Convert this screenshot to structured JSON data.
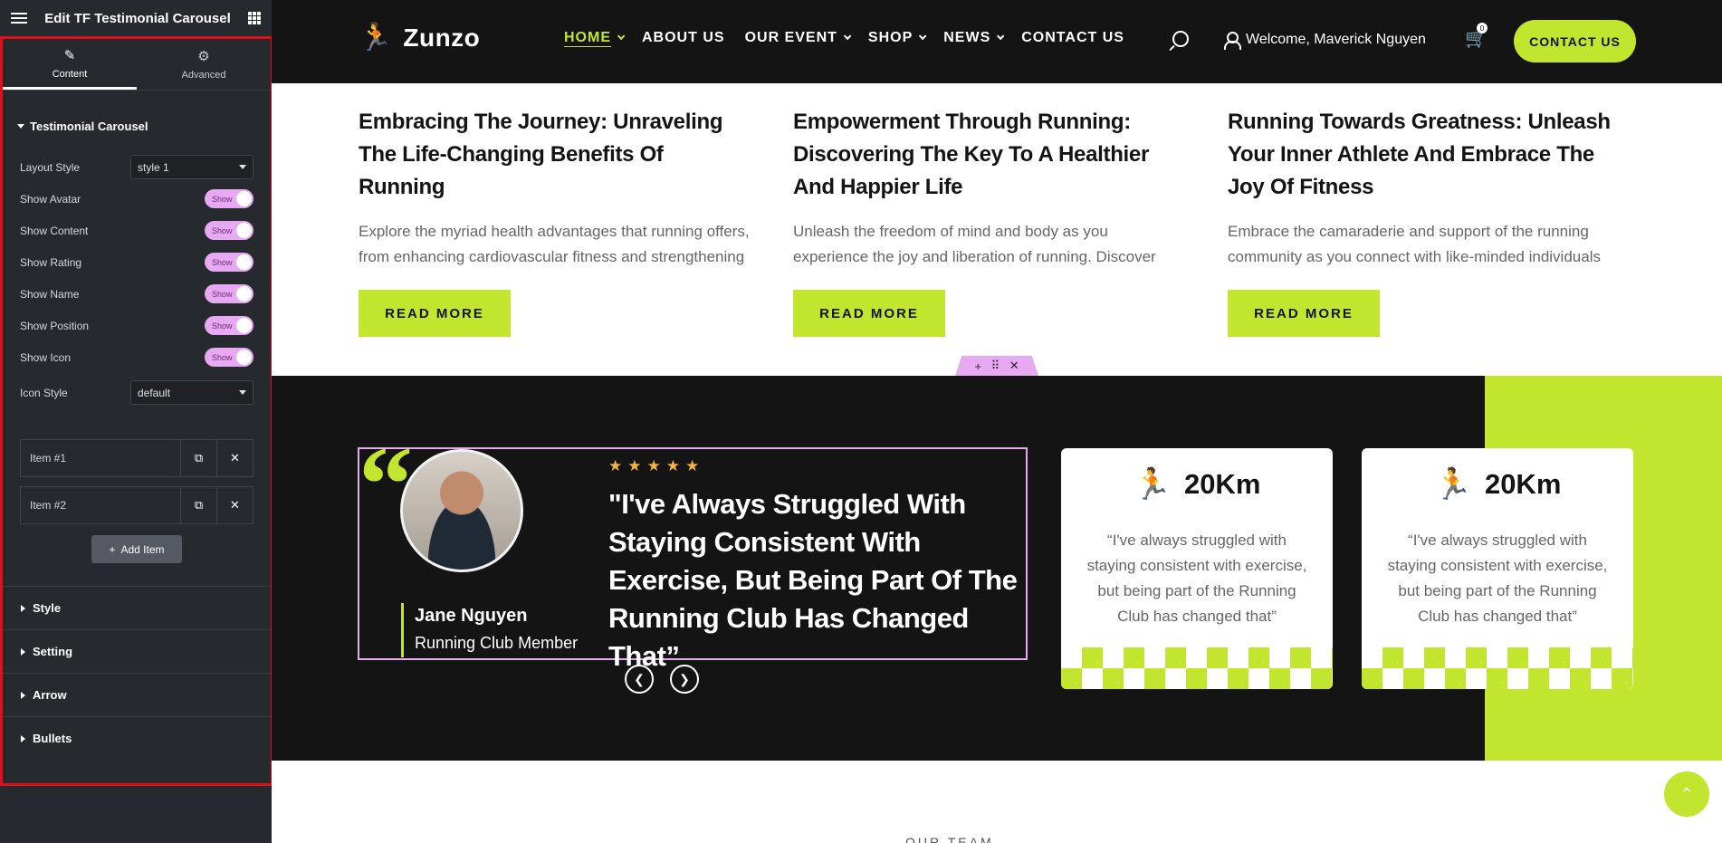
{
  "editor": {
    "title": "Edit TF Testimonial Carousel",
    "tabs": [
      {
        "label": "Content",
        "icon": "pencil-icon"
      },
      {
        "label": "Advanced",
        "icon": "gear-icon"
      }
    ],
    "section_title": "Testimonial Carousel",
    "layout_style": {
      "label": "Layout Style",
      "value": "style 1"
    },
    "toggles": [
      {
        "label": "Show Avatar",
        "state": "Show"
      },
      {
        "label": "Show Content",
        "state": "Show"
      },
      {
        "label": "Show Rating",
        "state": "Show"
      },
      {
        "label": "Show Name",
        "state": "Show"
      },
      {
        "label": "Show Position",
        "state": "Show"
      },
      {
        "label": "Show Icon",
        "state": "Show"
      }
    ],
    "icon_style": {
      "label": "Icon Style",
      "value": "default"
    },
    "items": [
      "Item #1",
      "Item #2"
    ],
    "add_item": "Add Item",
    "collapsed_sections": [
      "Style",
      "Setting",
      "Arrow",
      "Bullets"
    ]
  },
  "site": {
    "logo": "Zunzo",
    "nav": [
      {
        "label": "HOME",
        "dropdown": true,
        "active": true
      },
      {
        "label": "ABOUT US",
        "dropdown": false,
        "active": false
      },
      {
        "label": "OUR EVENT",
        "dropdown": true,
        "active": false
      },
      {
        "label": "SHOP",
        "dropdown": true,
        "active": false
      },
      {
        "label": "NEWS",
        "dropdown": true,
        "active": false
      },
      {
        "label": "CONTACT US",
        "dropdown": false,
        "active": false
      }
    ],
    "welcome": "Welcome, Maverick Nguyen",
    "cart_count": "0",
    "contact_button": "CONTACT US",
    "posts": [
      {
        "title": "Embracing The Journey: Unraveling The Life-Changing Benefits Of Running",
        "excerpt": "Explore the myriad health advantages that running offers, from enhancing cardiovascular fitness and strengthening",
        "button": "READ MORE"
      },
      {
        "title": "Empowerment Through Running: Discovering The Key To A Healthier And Happier Life",
        "excerpt": "Unleash the freedom of mind and body as you experience the joy and liberation of running. Discover how running",
        "button": "READ MORE"
      },
      {
        "title": "Running Towards Greatness: Unleash Your Inner Athlete And Embrace The Joy Of Fitness",
        "excerpt": "Embrace the camaraderie and support of the running community as you connect with like-minded individuals",
        "button": "READ MORE"
      }
    ],
    "testimonial": {
      "rating": 5,
      "quote": "\"I've Always Struggled With Staying Consistent With Exercise, But Being Part Of The Running Club Has Changed That”",
      "name": "Jane Nguyen",
      "position": "Running Club Member"
    },
    "mini_cards": [
      {
        "stat": "20Km",
        "text": "“I've always struggled with staying consistent with exercise, but being part of the Running Club has changed that”"
      },
      {
        "stat": "20Km",
        "text": "“I've always struggled with staying consistent with exercise, but being part of the Running Club has changed that”"
      }
    ],
    "next_section": "OUR TEAM",
    "colors": {
      "accent": "#c2e62d",
      "dark": "#141414",
      "editor_highlight": "#e7a9f1",
      "selection_border": "#e0101a"
    }
  }
}
